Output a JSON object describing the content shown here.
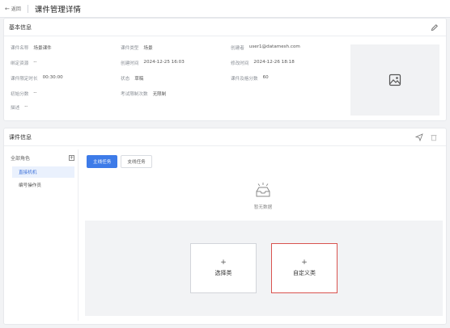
{
  "header": {
    "back_label": "返回",
    "title": "课件管理详情"
  },
  "basic": {
    "title": "基本信息",
    "fields": [
      {
        "key": "课件名称",
        "value": "场景课件"
      },
      {
        "key": "课件类型",
        "value": "场景"
      },
      {
        "key": "创建者",
        "value": "user1@datamesh.com"
      },
      {
        "key": "绑定资源",
        "value": "--"
      },
      {
        "key": "创建时间",
        "value": "2024-12-25 16:03"
      },
      {
        "key": "修改时间",
        "value": "2024-12-26 18:18"
      },
      {
        "key": "课件限定时长",
        "value": "00:30:00"
      },
      {
        "key": "状态",
        "value": "草稿"
      },
      {
        "key": "课件及格分数",
        "value": "60"
      },
      {
        "key": "初始分数",
        "value": "--"
      },
      {
        "key": "考试限制次数",
        "value": "无限制"
      },
      {
        "key": "描述",
        "value": "--"
      }
    ],
    "icons": {
      "edit": "pencil-icon",
      "image": "image-placeholder-icon"
    }
  },
  "course": {
    "title": "课件信息",
    "icons": {
      "send": "send-icon",
      "delete": "trash-icon"
    },
    "sidebar": {
      "title": "全部角色",
      "add_icon": "plus-square-icon",
      "items": [
        {
          "label": "直接机机",
          "active": true
        },
        {
          "label": "编号操作员",
          "active": false
        }
      ]
    },
    "tabs": [
      {
        "label": "主线任务",
        "active": true
      },
      {
        "label": "支线任务",
        "active": false
      }
    ],
    "empty_text": "暂无数据",
    "choices": [
      {
        "plus": "+",
        "label": "选择类",
        "selected": false
      },
      {
        "plus": "+",
        "label": "自定义类",
        "selected": true
      }
    ]
  },
  "colors": {
    "accent": "#3d7be8",
    "selected_border": "#d9534f"
  }
}
